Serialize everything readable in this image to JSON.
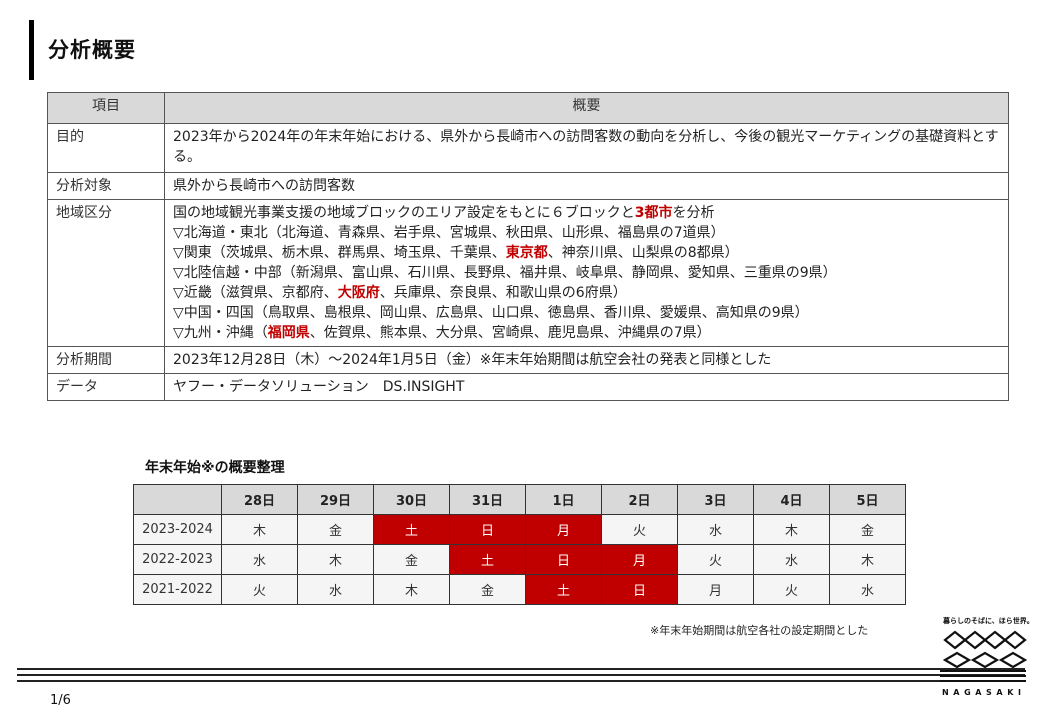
{
  "page": {
    "title": "分析概要",
    "page_number": "1/6"
  },
  "summary_table": {
    "headers": [
      "項目",
      "概要"
    ],
    "rows": [
      {
        "label": "目的",
        "content": "2023年から2024年の年末年始における、県外から長崎市への訪問客数の動向を分析し、今後の観光マーケティングの基礎資料とする。"
      },
      {
        "label": "分析対象",
        "content": "県外から長崎市への訪問客数"
      },
      {
        "label": "地域区分",
        "intro_prefix": "国の地域観光事業支援の地域ブロックのエリア設定をもとに６ブロックと",
        "intro_highlight": "3都市",
        "intro_suffix": "を分析",
        "lines": [
          {
            "pre": "▽北海道・東北（北海道、青森県、岩手県、宮城県、秋田県、山形県、福島県の7道県）",
            "hl": "",
            "post": ""
          },
          {
            "pre": "▽関東（茨城県、栃木県、群馬県、埼玉県、千葉県、",
            "hl": "東京都",
            "post": "、神奈川県、山梨県の8都県）"
          },
          {
            "pre": "▽北陸信越・中部（新潟県、富山県、石川県、長野県、福井県、岐阜県、静岡県、愛知県、三重県の9県）",
            "hl": "",
            "post": ""
          },
          {
            "pre": "▽近畿（滋賀県、京都府、",
            "hl": "大阪府",
            "post": "、兵庫県、奈良県、和歌山県の6府県）"
          },
          {
            "pre": "▽中国・四国（鳥取県、島根県、岡山県、広島県、山口県、徳島県、香川県、愛媛県、高知県の9県）",
            "hl": "",
            "post": ""
          },
          {
            "pre": "▽九州・沖縄（",
            "hl": "福岡県",
            "post": "、佐賀県、熊本県、大分県、宮崎県、鹿児島県、沖縄県の7県）"
          }
        ]
      },
      {
        "label": "分析期間",
        "content": "2023年12月28日（木）～2024年1月5日（金）※年末年始期間は航空会社の発表と同様とした"
      },
      {
        "label": "データ",
        "content": "ヤフー・データソリューション　DS.INSIGHT"
      }
    ]
  },
  "calendar": {
    "title": "年末年始※の概要整理",
    "days": [
      "28日",
      "29日",
      "30日",
      "31日",
      "1日",
      "2日",
      "3日",
      "4日",
      "5日"
    ],
    "rows": [
      {
        "year": "2023-2024",
        "weekdays": [
          "木",
          "金",
          "土",
          "日",
          "月",
          "火",
          "水",
          "木",
          "金"
        ],
        "holiday": [
          false,
          false,
          true,
          true,
          true,
          false,
          false,
          false,
          false
        ]
      },
      {
        "year": "2022-2023",
        "weekdays": [
          "水",
          "木",
          "金",
          "土",
          "日",
          "月",
          "火",
          "水",
          "木"
        ],
        "holiday": [
          false,
          false,
          false,
          true,
          true,
          true,
          false,
          false,
          false
        ]
      },
      {
        "year": "2021-2022",
        "weekdays": [
          "火",
          "水",
          "木",
          "金",
          "土",
          "日",
          "月",
          "火",
          "水"
        ],
        "holiday": [
          false,
          false,
          false,
          false,
          true,
          true,
          false,
          false,
          false
        ]
      }
    ],
    "holiday_color": "#c00000",
    "footnote": "※年末年始期間は航空各社の設定期間とした"
  },
  "logo": {
    "tagline": "暮らしのそばに、ほら世界。",
    "name": "NAGASAKI"
  }
}
